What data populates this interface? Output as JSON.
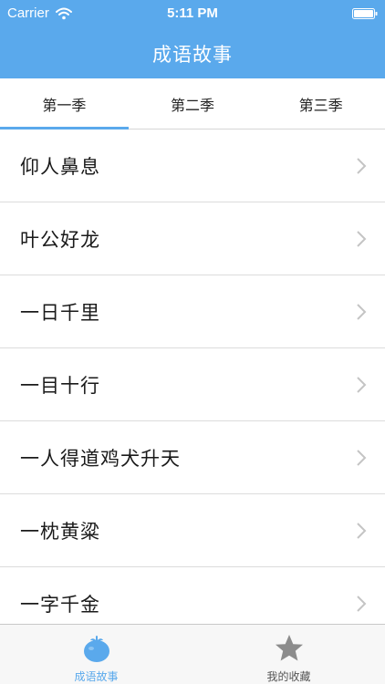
{
  "status_bar": {
    "carrier": "Carrier",
    "time": "5:11 PM"
  },
  "nav": {
    "title": "成语故事"
  },
  "season_tabs": [
    {
      "label": "第一季",
      "selected": true
    },
    {
      "label": "第二季",
      "selected": false
    },
    {
      "label": "第三季",
      "selected": false
    }
  ],
  "idioms": [
    {
      "label": "仰人鼻息"
    },
    {
      "label": "叶公好龙"
    },
    {
      "label": "一日千里"
    },
    {
      "label": "一目十行"
    },
    {
      "label": "一人得道鸡犬升天"
    },
    {
      "label": "一枕黄粱"
    },
    {
      "label": "一字千金"
    }
  ],
  "tabbar": {
    "items": [
      {
        "label": "成语故事",
        "icon": "tomato-icon",
        "active": true
      },
      {
        "label": "我的收藏",
        "icon": "star-icon",
        "active": false
      }
    ]
  },
  "colors": {
    "accent": "#5aa9ec",
    "background": "#f2f2f2",
    "text": "#1a1a1a"
  }
}
